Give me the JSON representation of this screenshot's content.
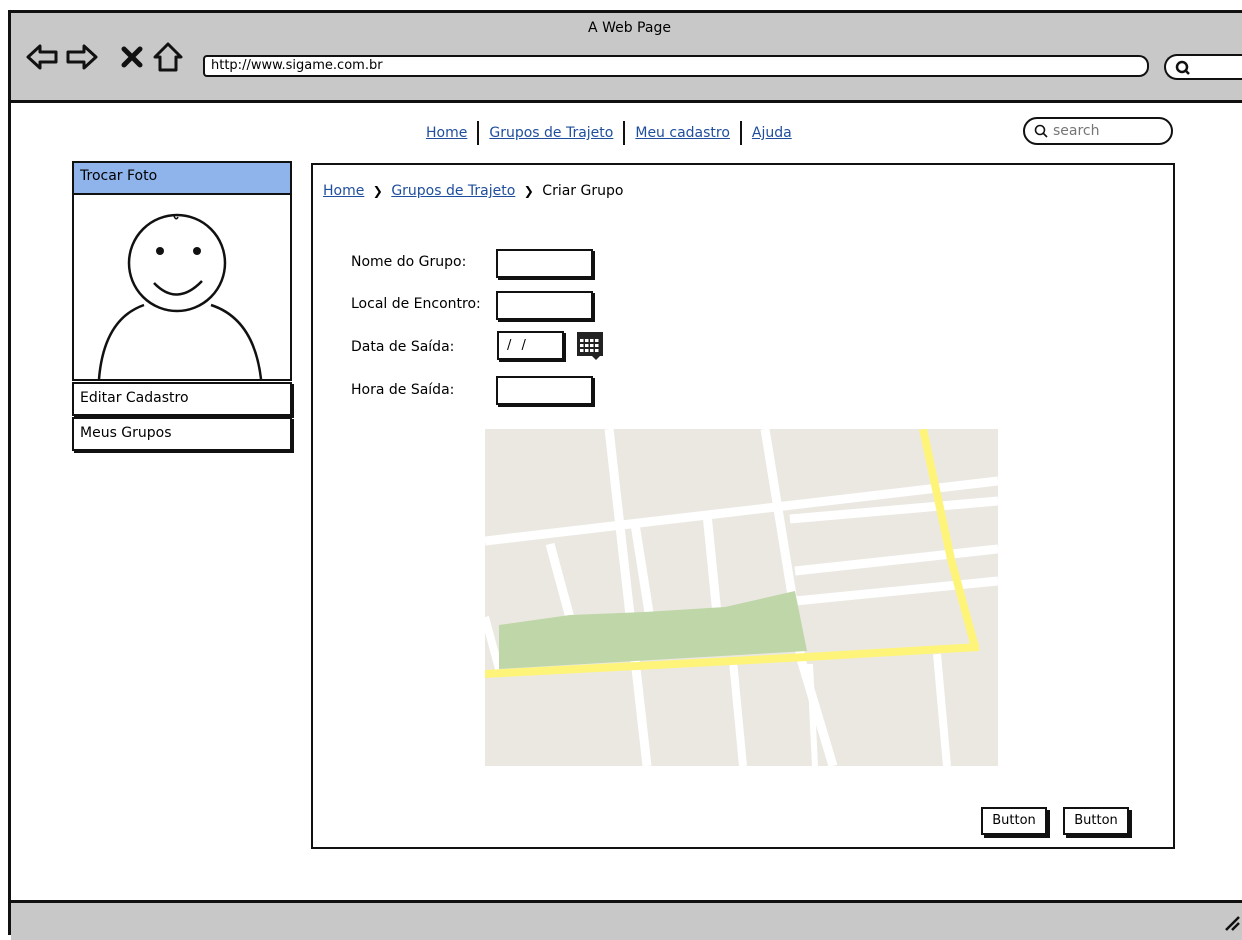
{
  "window": {
    "title": "A Web Page",
    "address": "http://www.sigame.com.br"
  },
  "topnav": {
    "items": [
      "Home",
      "Grupos de Trajeto",
      "Meu cadastro",
      "Ajuda"
    ]
  },
  "search": {
    "placeholder": "search"
  },
  "sidebar": {
    "photo_label": "Trocar Foto",
    "items": [
      "Editar Cadastro",
      "Meus Grupos"
    ]
  },
  "breadcrumb": {
    "items": [
      "Home",
      "Grupos de Trajeto",
      "Criar Grupo"
    ]
  },
  "form": {
    "name_label": "Nome do Grupo:",
    "place_label": "Local de Encontro:",
    "date_label": "Data de Saída:",
    "date_value": "/ /",
    "time_label": "Hora de Saída:"
  },
  "buttons": {
    "primary": "Button",
    "secondary": "Button"
  },
  "colors": {
    "highlight": "#8fb4ec",
    "link": "#1f4e9c",
    "chrome": "#c8c8c8",
    "map_bg": "#ebe8e2",
    "map_road_major": "#fff47a",
    "map_park": "#bfd6a8"
  }
}
